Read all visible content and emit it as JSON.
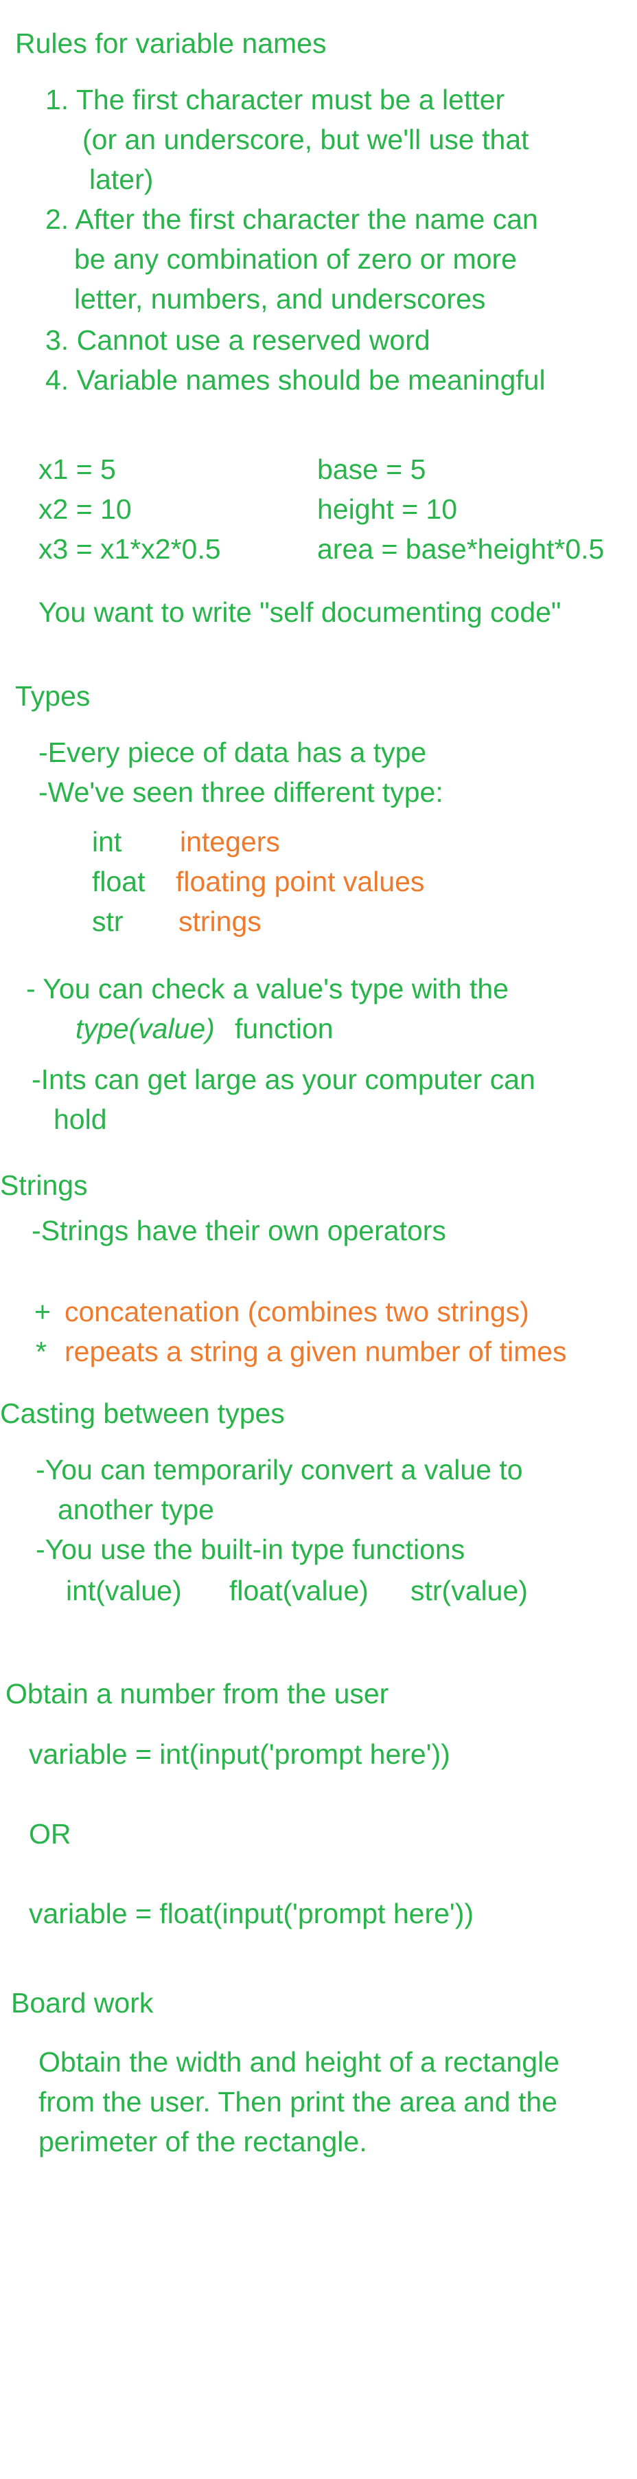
{
  "variable_rules": {
    "heading": "Rules for variable names",
    "rule1_line1": "1. The first character must be a letter",
    "rule1_line2": "(or an underscore, but we'll use that",
    "rule1_line3": "later)",
    "rule2_line1": "2. After the first character the name can",
    "rule2_line2": "be any combination of zero or more",
    "rule2_line3": "letter, numbers, and underscores",
    "rule3": "3. Cannot use a reserved word",
    "rule4": "4. Variable names should be meaningful",
    "example_left": [
      "x1 = 5",
      "x2 = 10",
      "x3 = x1*x2*0.5"
    ],
    "example_right": [
      "base = 5",
      "height = 10",
      "area = base*height*0.5"
    ],
    "self_doc_note": "You want to write \"self documenting code\""
  },
  "types": {
    "heading": "Types",
    "line1": "-Every piece of data has a type",
    "line2": "-We've seen three different type:",
    "type_names": [
      "int",
      "float",
      "str"
    ],
    "type_descriptions": [
      "integers",
      "floating point values",
      "strings"
    ],
    "check_line1": "- You can check a value's type with the",
    "check_func": "type(value)",
    "check_suffix": "function",
    "ints_line1": "-Ints can get large as your computer can",
    "ints_line2": "hold"
  },
  "strings": {
    "heading": "Strings",
    "line1": "-Strings have their own operators",
    "op_plus_symbol": "+",
    "op_plus_desc": "concatenation (combines two strings)",
    "op_star_symbol": "*",
    "op_star_desc": "repeats a string a given number of times"
  },
  "casting": {
    "heading": "Casting between types",
    "line1": "-You can temporarily convert a value to",
    "line2": "another type",
    "line3": "-You use the built-in type functions",
    "functions": [
      "int(value)",
      "float(value)",
      "str(value)"
    ]
  },
  "user_input": {
    "heading": "Obtain a number from the user",
    "code1": "variable = int(input('prompt here'))",
    "or": "OR",
    "code2": "variable = float(input('prompt here'))"
  },
  "board_work": {
    "heading": "Board work",
    "line1": "Obtain the width and height of a rectangle",
    "line2": "from the user. Then print the area and the",
    "line3": "perimeter of the rectangle."
  },
  "colors": {
    "ink_green": "#28b44a",
    "ink_orange": "#f07a2c",
    "background": "#ffffff"
  }
}
